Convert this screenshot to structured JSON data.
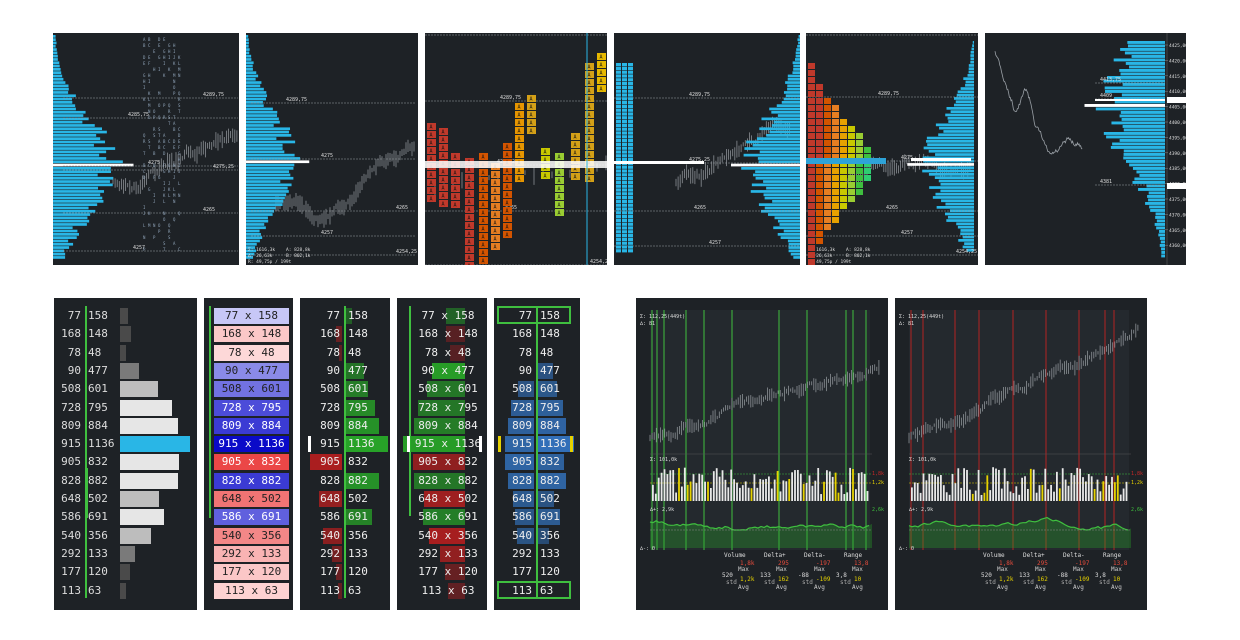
{
  "profiles": [
    {
      "id": "p1",
      "levels": [
        "4289,75",
        "4285,75",
        "4275",
        "4275,25",
        "4265",
        "4257"
      ]
    },
    {
      "id": "p2",
      "levels": [
        "4289,75",
        "4275",
        "4265",
        "4257",
        "4254,25"
      ],
      "stats": [
        "Σ: 1616,3k",
        "A: 828,8k",
        "∆: 26,63k",
        "B: 802,1k",
        "R: 49,75p / 199t"
      ]
    },
    {
      "id": "p3",
      "levels": [
        "4289,75",
        "4275,25",
        "4265",
        "4254,25",
        "4304"
      ]
    },
    {
      "id": "p4",
      "levels": [
        "4289,75",
        "4275,25",
        "4265",
        "4257"
      ]
    },
    {
      "id": "p5",
      "levels": [
        "4289,75",
        "4275",
        "4265",
        "4257",
        "4254,25",
        "4304"
      ],
      "stats": [
        "Σ: 1616,3k",
        "A: 828,8k",
        "∆: 26,63k",
        "B: 802,1k",
        "R: 49,75p / 199t"
      ]
    },
    {
      "id": "p6",
      "levels": [
        "4413,75",
        "4409",
        "4381"
      ],
      "axis": [
        "4425,00",
        "4420,00",
        "4415,00",
        "4410,00",
        "4405,00",
        "4400,00",
        "4395,00",
        "4390,00",
        "4385,00",
        "4380,00",
        "4375,00",
        "4370,00",
        "4365,00",
        "4360,00"
      ]
    }
  ],
  "footprint": {
    "rows": [
      {
        "bid": "77",
        "ask": "158"
      },
      {
        "bid": "168",
        "ask": "148"
      },
      {
        "bid": "78",
        "ask": "48"
      },
      {
        "bid": "90",
        "ask": "477"
      },
      {
        "bid": "508",
        "ask": "601"
      },
      {
        "bid": "728",
        "ask": "795"
      },
      {
        "bid": "809",
        "ask": "884"
      },
      {
        "bid": "915",
        "ask": "1136"
      },
      {
        "bid": "905",
        "ask": "832"
      },
      {
        "bid": "828",
        "ask": "882"
      },
      {
        "bid": "648",
        "ask": "502"
      },
      {
        "bid": "586",
        "ask": "691"
      },
      {
        "bid": "540",
        "ask": "356"
      },
      {
        "bid": "292",
        "ask": "133"
      },
      {
        "bid": "177",
        "ask": "120"
      },
      {
        "bid": "113",
        "ask": "63"
      }
    ],
    "separator": "x"
  },
  "charts": [
    {
      "id": "c1",
      "price": "Σ: 112,25(449t)",
      "sub": "∆: 81",
      "vol": "Σ: 101,0k",
      "delta": "∆+: 2,9k",
      "deltaMin": "∆-: 0",
      "right": [
        "1,8k",
        "1,2k",
        "2,6k"
      ]
    },
    {
      "id": "c2",
      "price": "Σ: 112,25(449t)",
      "sub": "∆: 81",
      "vol": "Σ: 101,0k",
      "delta": "∆+: 2,9k",
      "deltaMin": "∆-: 0",
      "right": [
        "1,8k",
        "1,2k",
        "2,6k"
      ]
    }
  ],
  "stats_table": {
    "headers": [
      "Volume",
      "Delta+",
      "Delta-",
      "Range"
    ],
    "volume": {
      "value": "520",
      "label": "std",
      "max_label": "Max",
      "max": "1,8k",
      "avg_label": "Avg",
      "avg": "1,2k"
    },
    "deltaP": {
      "value": "133",
      "label": "std",
      "max": "295",
      "avg": "162"
    },
    "deltaM": {
      "value": "-88",
      "label": "std",
      "max": "-197",
      "avg": "-109"
    },
    "range": {
      "value": "3,8",
      "label": "std",
      "max": "13,8",
      "avg": "10"
    }
  },
  "colors": {
    "bg": "#1e2226",
    "cyan": "#29b6e6",
    "green": "#3fbf3f",
    "red": "#c0392b"
  }
}
